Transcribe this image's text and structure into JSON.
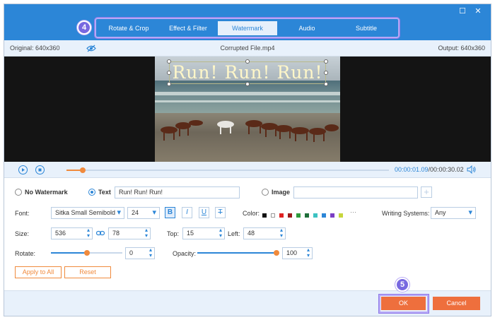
{
  "tabs": [
    "Rotate & Crop",
    "Effect & Filter",
    "Watermark",
    "Audio",
    "Subtitle"
  ],
  "active_tab": "Watermark",
  "steps": {
    "tabs_step": "4",
    "ok_step": "5"
  },
  "info": {
    "original": "Original: 640x360",
    "filename": "Corrupted File.mp4",
    "output": "Output: 640x360"
  },
  "watermark_preview_text": "Run! Run! Run!",
  "playback": {
    "current": "00:00:01.09",
    "total": "/00:00:30.02",
    "progress": 0.05
  },
  "watermark": {
    "no_watermark_label": "No Watermark",
    "text_label": "Text",
    "text_value": "Run! Run! Run!",
    "image_label": "Image",
    "image_value": "",
    "selected": "Text"
  },
  "font": {
    "label": "Font:",
    "family": "Sitka Small Semibold",
    "size": "24",
    "bold": "B",
    "italic": "I",
    "underline": "U",
    "strike": "T",
    "bold_active": true
  },
  "color": {
    "label": "Color:",
    "swatches": [
      "#111111",
      "#ffffff",
      "#e02020",
      "#9b1b1b",
      "#2e9b3c",
      "#1f6e3a",
      "#3cc2c2",
      "#2c86d7",
      "#7b3fc4",
      "#c7d63c"
    ],
    "more": "···"
  },
  "writing": {
    "label": "Writing Systems:",
    "value": "Any"
  },
  "size": {
    "label": "Size:",
    "width": "536",
    "height": "78"
  },
  "position": {
    "top_label": "Top:",
    "top": "15",
    "left_label": "Left:",
    "left": "48"
  },
  "rotate": {
    "label": "Rotate:",
    "value": "0",
    "level": 0.5
  },
  "opacity": {
    "label": "Opacity:",
    "value": "100",
    "level": 1.0
  },
  "buttons": {
    "apply_all": "Apply to All",
    "reset": "Reset",
    "ok": "OK",
    "cancel": "Cancel"
  },
  "colors": {
    "accent": "#2c86d7",
    "orange": "#ee6f3d",
    "highlight": "#7868e0"
  }
}
